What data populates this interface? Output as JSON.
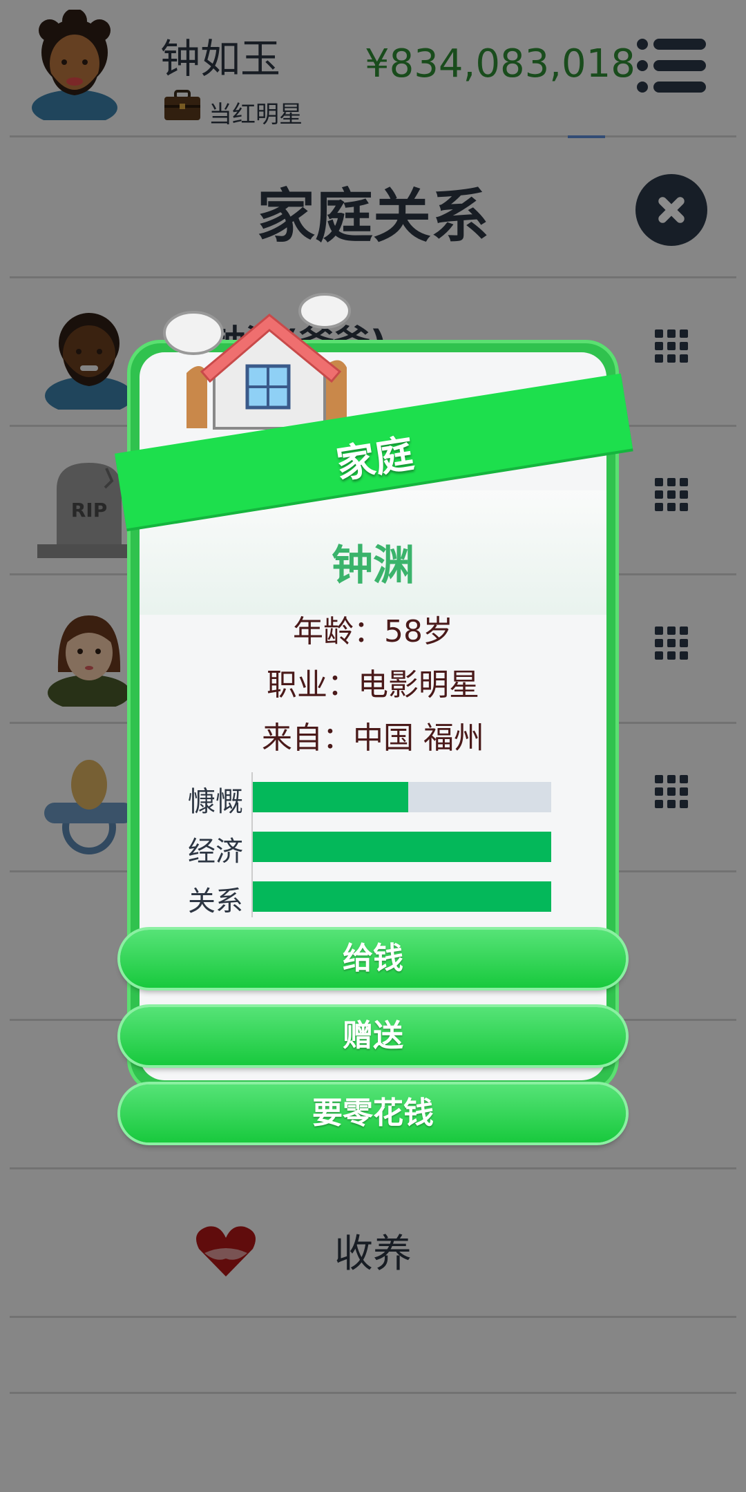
{
  "header": {
    "name": "钟如玉",
    "job": "当红明星",
    "money": "¥834,083,018",
    "menu_icon": "menu-icon"
  },
  "page": {
    "title": "家庭关系",
    "close_icon": "close-icon"
  },
  "family_rows": [
    {
      "name": "钟渊(爸爸)",
      "avatar": "male-avatar"
    },
    {
      "name": "",
      "avatar": "rip-tombstone"
    },
    {
      "name": "",
      "avatar": "female-avatar"
    },
    {
      "name": "",
      "avatar": "pacifier-icon"
    }
  ],
  "adopt": {
    "label": "收养",
    "icon": "heart-hands-icon"
  },
  "modal": {
    "banner": "家庭",
    "person_name": "钟渊",
    "age": "年龄：58岁",
    "job": "职业：电影明星",
    "origin": "来自：中国 福州",
    "stats": [
      {
        "label": "慷慨",
        "value": 0.52
      },
      {
        "label": "经济",
        "value": 1.0
      },
      {
        "label": "关系",
        "value": 1.0
      }
    ],
    "buttons": [
      "给钱",
      "赠送",
      "要零花钱"
    ]
  },
  "colors": {
    "money": "#2e8a33",
    "card_green": "#30c24e",
    "stat_bar": "#04b85a",
    "name_green": "#3ab36b"
  }
}
